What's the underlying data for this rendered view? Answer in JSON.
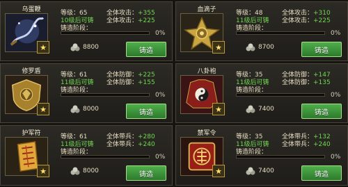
{
  "labels": {
    "level_prefix": "等级：",
    "stage_label": "铸造阶段：",
    "forge_button": "铸造",
    "percent_suffix": "%"
  },
  "cards": [
    {
      "name": "乌蛋鞭",
      "level": "65",
      "stat1_label": "全体攻击：",
      "stat1_value": "+355",
      "green_line": "10级后可铸",
      "stat2_label": "全体攻击：",
      "stat2_value": "+225",
      "progress_pct": "0",
      "cost": "8800",
      "icon": "whip-icon"
    },
    {
      "name": "血滴子",
      "level": "48",
      "stat1_label": "全体攻击：",
      "stat1_value": "+310",
      "green_line": "11级后可铸",
      "stat2_label": "全体攻击：",
      "stat2_value": "+225",
      "progress_pct": "0",
      "cost": "8700",
      "icon": "blade-disk-icon"
    },
    {
      "name": "修罗盾",
      "level": "61",
      "stat1_label": "全体防御：",
      "stat1_value": "+225",
      "green_line": "11级后可铸",
      "stat2_label": "全体防御：",
      "stat2_value": "+155",
      "progress_pct": "0",
      "cost": "8000",
      "icon": "shield-icon"
    },
    {
      "name": "八卦袍",
      "level": "35",
      "stat1_label": "全体防御：",
      "stat1_value": "+147",
      "green_line": "11级后可铸",
      "stat2_label": "全体防御：",
      "stat2_value": "+135",
      "progress_pct": "0",
      "cost": "7400",
      "icon": "bagua-robe-icon"
    },
    {
      "name": "护军符",
      "level": "61",
      "stat1_label": "全体带兵：",
      "stat1_value": "+280",
      "green_line": "11级后可铸",
      "stat2_label": "全体带兵：",
      "stat2_value": "+240",
      "progress_pct": "0",
      "cost": "8000",
      "icon": "talisman-icon"
    },
    {
      "name": "禁军令",
      "level": "35",
      "stat1_label": "全体带兵：",
      "stat1_value": "+132",
      "green_line": "11级后可铸",
      "stat2_label": "全体带兵：",
      "stat2_value": "+240",
      "progress_pct": "0",
      "cost": "7400",
      "icon": "token-icon"
    }
  ],
  "colors": {
    "green": "#6fd84f",
    "button": "#3f9a3c",
    "gold": "#c9a640"
  }
}
